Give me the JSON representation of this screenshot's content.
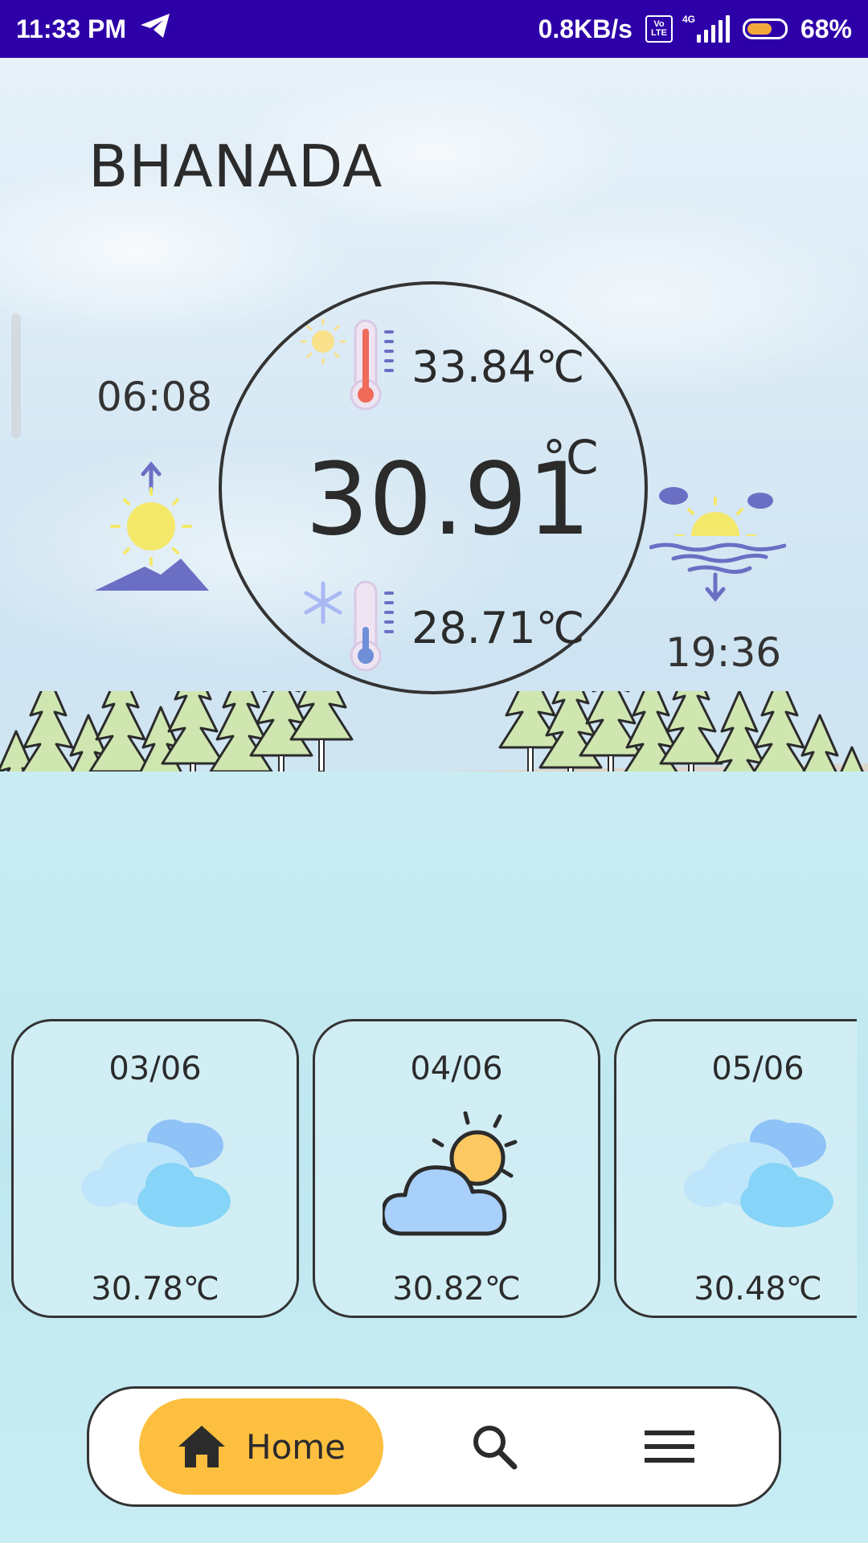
{
  "status_bar": {
    "time": "11:33 PM",
    "network_speed": "0.8KB/s",
    "volte_top": "Vo",
    "volte_bottom": "LTE",
    "network_type": "4G",
    "battery_percent": "68%",
    "battery_level": 0.68,
    "icons": [
      "telegram-icon",
      "volte-icon",
      "signal-icon",
      "battery-icon"
    ]
  },
  "location": {
    "city": "BHANADA"
  },
  "current": {
    "temperature": "30.91",
    "unit": "°C",
    "max_temp": "33.84℃",
    "min_temp": "28.71℃",
    "sunrise": "06:08",
    "sunset": "19:36"
  },
  "forecast": [
    {
      "date": "03/06",
      "temp": "30.78℃",
      "icon": "clouds-icon"
    },
    {
      "date": "04/06",
      "temp": "30.82℃",
      "icon": "partly-cloudy-icon"
    },
    {
      "date": "05/06",
      "temp": "30.48℃",
      "icon": "clouds-icon"
    }
  ],
  "nav": {
    "home_label": "Home",
    "items": [
      "home-icon",
      "search-icon",
      "menu-icon"
    ]
  },
  "colors": {
    "status_bar": "#2e00a8",
    "nav_active": "#fdbf3f",
    "text": "#2b2b2b",
    "accent_purple": "#6b6fc4",
    "sun_yellow": "#f4e86a"
  }
}
